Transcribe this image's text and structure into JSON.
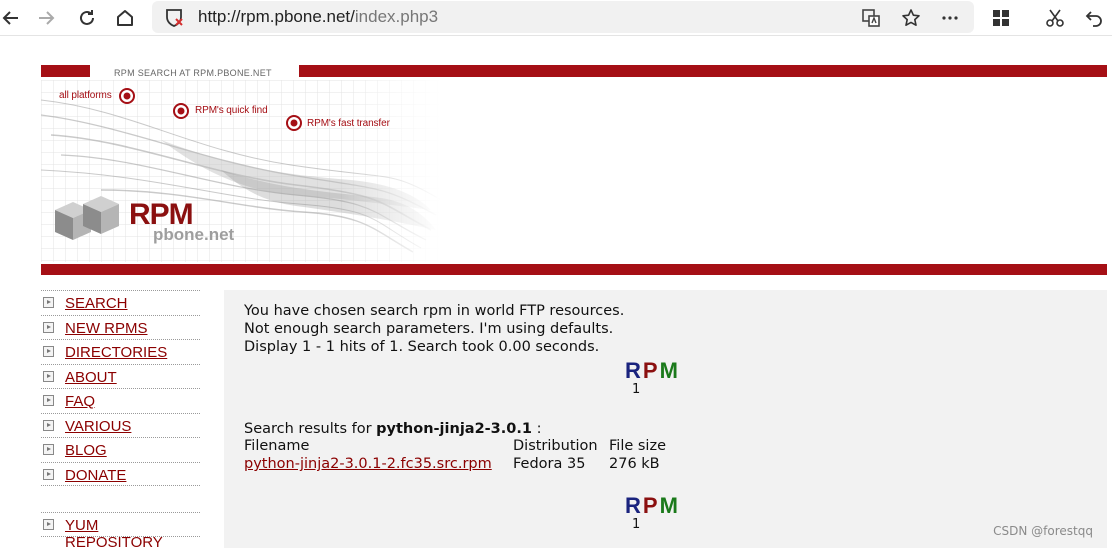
{
  "browser": {
    "url_host": "http://rpm.pbone.net/",
    "url_path": "index.php3",
    "icons": [
      "back-icon",
      "forward-icon",
      "reload-icon",
      "home-icon",
      "not-secure-icon",
      "translate-icon",
      "favorite-star-icon",
      "more-icon",
      "apps-grid-icon",
      "screenshot-scissors-icon",
      "undo-icon"
    ]
  },
  "banner": {
    "caption": "RPM SEARCH AT RPM.PBONE.NET",
    "labels": [
      "all platforms",
      "RPM's quick find",
      "RPM's fast transfer"
    ],
    "logo_main": "RPM",
    "logo_sub": "pbone.net",
    "accent_color": "#a50f15"
  },
  "sidebar": {
    "items": [
      {
        "label": "SEARCH"
      },
      {
        "label": "NEW RPMS"
      },
      {
        "label": "DIRECTORIES"
      },
      {
        "label": "ABOUT"
      },
      {
        "label": "FAQ"
      },
      {
        "label": "VARIOUS"
      },
      {
        "label": "BLOG"
      },
      {
        "label": "DONATE"
      },
      {
        "label": "YUM REPOSITORY"
      }
    ]
  },
  "content": {
    "line1": "You have chosen search rpm in world FTP resources.",
    "line2": "Not enough search parameters. I'm using defaults.",
    "line3": "Display 1 - 1 hits of 1. Search took 0.00 seconds.",
    "rpm_r": "R",
    "rpm_p": "P",
    "rpm_m": "M",
    "page_number": "1",
    "results_prefix": "Search results for",
    "query": "python-jinja2-3.0.1",
    "results_suffix": ":",
    "columns": {
      "filename": "Filename",
      "distribution": "Distribution",
      "size": "File size"
    },
    "rows": [
      {
        "filename": "python-jinja2-3.0.1-2.fc35.src.rpm",
        "distribution": "Fedora 35",
        "size": "276 kB"
      }
    ]
  },
  "watermark": "CSDN @forestqq"
}
